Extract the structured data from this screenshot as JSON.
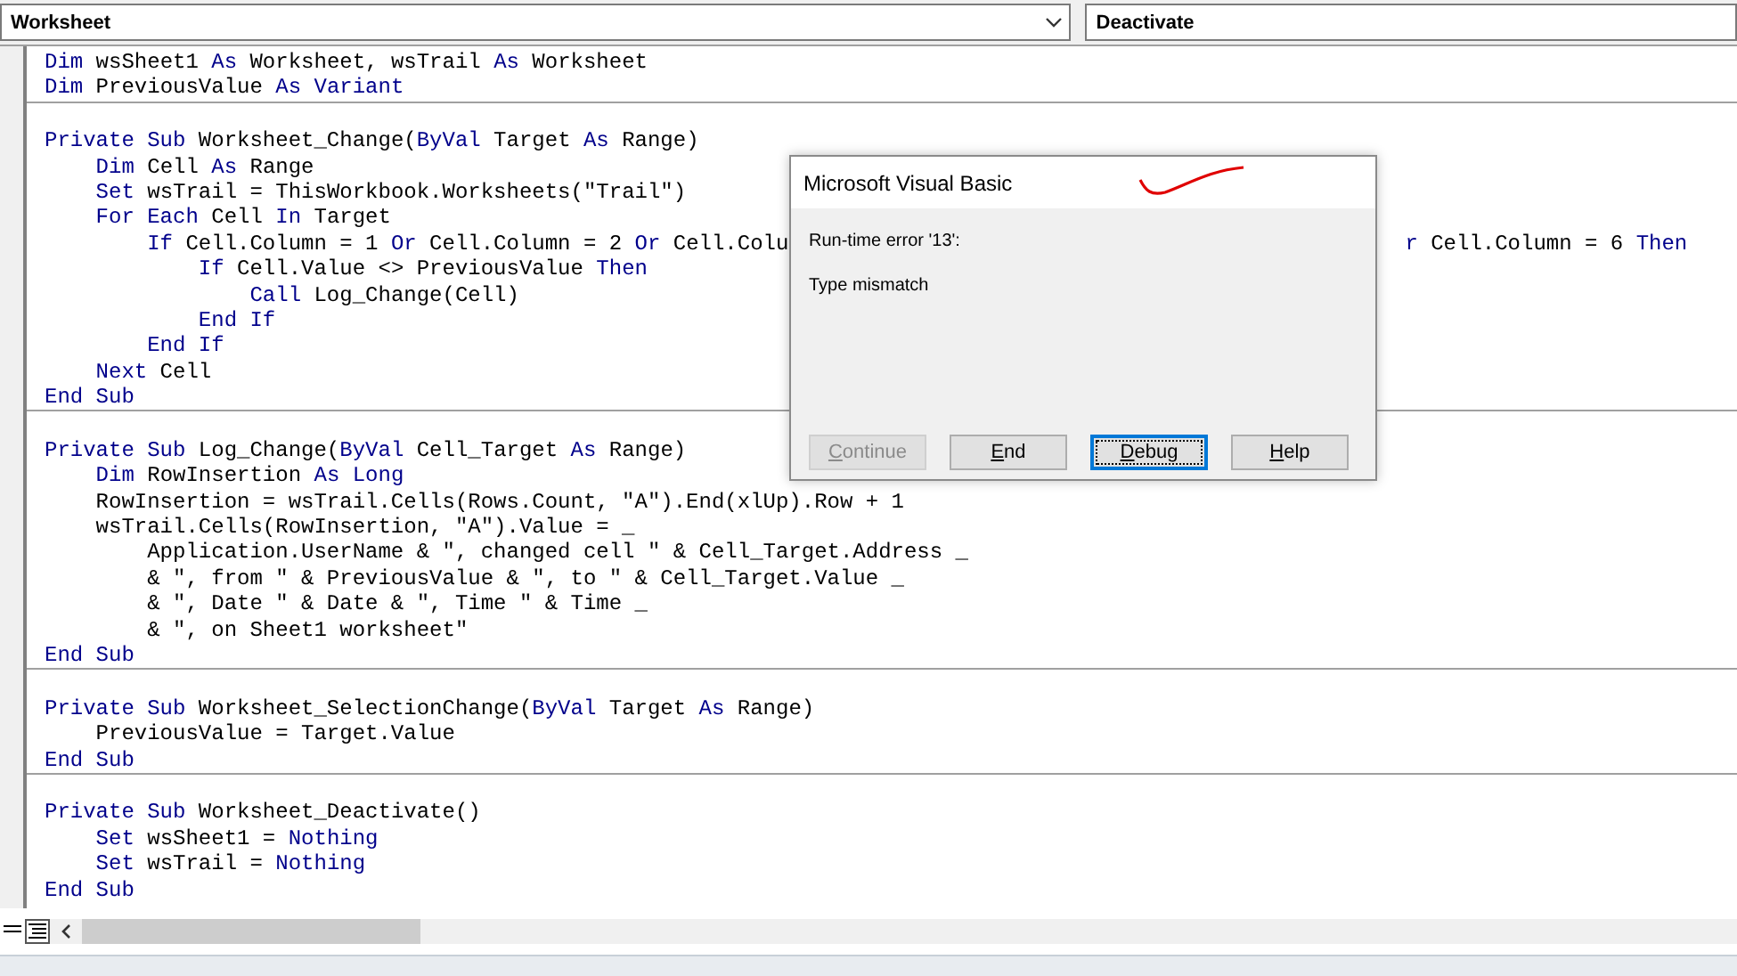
{
  "object_box": {
    "value": "Worksheet",
    "has_arrow": true
  },
  "procedure_box": {
    "value": "Deactivate",
    "has_arrow": false
  },
  "code_blocks": [
    {
      "lines": [
        {
          "segments": [
            {
              "text": "Dim",
              "kind": "keyword"
            },
            {
              "text": " wsSheet1 ",
              "kind": "plain"
            },
            {
              "text": "As",
              "kind": "keyword"
            },
            {
              "text": " Worksheet, wsTrail ",
              "kind": "plain"
            },
            {
              "text": "As",
              "kind": "keyword"
            },
            {
              "text": " Worksheet",
              "kind": "plain"
            }
          ]
        },
        {
          "segments": [
            {
              "text": "Dim",
              "kind": "keyword"
            },
            {
              "text": " PreviousValue ",
              "kind": "plain"
            },
            {
              "text": "As Variant",
              "kind": "keyword"
            }
          ]
        }
      ]
    },
    {
      "lines": [
        {
          "segments": [
            {
              "text": "Private Sub",
              "kind": "keyword"
            },
            {
              "text": " Worksheet_Change(",
              "kind": "plain"
            },
            {
              "text": "ByVal",
              "kind": "keyword"
            },
            {
              "text": " Target ",
              "kind": "plain"
            },
            {
              "text": "As",
              "kind": "keyword"
            },
            {
              "text": " Range)",
              "kind": "plain"
            }
          ]
        },
        {
          "segments": [
            {
              "text": "    Dim",
              "kind": "keyword"
            },
            {
              "text": " Cell ",
              "kind": "plain"
            },
            {
              "text": "As",
              "kind": "keyword"
            },
            {
              "text": " Range",
              "kind": "plain"
            }
          ]
        },
        {
          "segments": [
            {
              "text": "    Set",
              "kind": "keyword"
            },
            {
              "text": " wsTrail = ThisWorkbook.Worksheets(\"Trail\")",
              "kind": "plain"
            }
          ]
        },
        {
          "segments": [
            {
              "text": "    For Each",
              "kind": "keyword"
            },
            {
              "text": " Cell ",
              "kind": "plain"
            },
            {
              "text": "In",
              "kind": "keyword"
            },
            {
              "text": " Target",
              "kind": "plain"
            }
          ]
        },
        {
          "segments": [
            {
              "text": "        If",
              "kind": "keyword"
            },
            {
              "text": " Cell.Column = 1 ",
              "kind": "plain"
            },
            {
              "text": "Or",
              "kind": "keyword"
            },
            {
              "text": " Cell.Column = 2 ",
              "kind": "plain"
            },
            {
              "text": "Or",
              "kind": "keyword"
            },
            {
              "text": " Cell.Colu",
              "kind": "plain"
            }
          ],
          "after_dialog": [
            {
              "text": "r",
              "kind": "keyword"
            },
            {
              "text": " Cell.Column = 6 ",
              "kind": "plain"
            },
            {
              "text": "Then",
              "kind": "keyword"
            }
          ]
        },
        {
          "segments": [
            {
              "text": "            If",
              "kind": "keyword"
            },
            {
              "text": " Cell.Value <> PreviousValue ",
              "kind": "plain"
            },
            {
              "text": "Then",
              "kind": "keyword"
            }
          ]
        },
        {
          "segments": [
            {
              "text": "                Call",
              "kind": "keyword"
            },
            {
              "text": " Log_Change(Cell)",
              "kind": "plain"
            }
          ]
        },
        {
          "segments": [
            {
              "text": "            End If",
              "kind": "keyword"
            }
          ]
        },
        {
          "segments": [
            {
              "text": "        End If",
              "kind": "keyword"
            }
          ]
        },
        {
          "segments": [
            {
              "text": "    Next",
              "kind": "keyword"
            },
            {
              "text": " Cell",
              "kind": "plain"
            }
          ]
        },
        {
          "segments": [
            {
              "text": "End Sub",
              "kind": "keyword"
            }
          ]
        }
      ]
    },
    {
      "lines": [
        {
          "segments": [
            {
              "text": "Private Sub",
              "kind": "keyword"
            },
            {
              "text": " Log_Change(",
              "kind": "plain"
            },
            {
              "text": "ByVal",
              "kind": "keyword"
            },
            {
              "text": " Cell_Target ",
              "kind": "plain"
            },
            {
              "text": "As",
              "kind": "keyword"
            },
            {
              "text": " Range)",
              "kind": "plain"
            }
          ]
        },
        {
          "segments": [
            {
              "text": "    Dim",
              "kind": "keyword"
            },
            {
              "text": " RowInsertion ",
              "kind": "plain"
            },
            {
              "text": "As Long",
              "kind": "keyword"
            }
          ]
        },
        {
          "segments": [
            {
              "text": "    RowInsertion = wsTrail.Cells(Rows.Count, \"A\").End(xlUp).Row + 1",
              "kind": "plain"
            }
          ]
        },
        {
          "segments": [
            {
              "text": "    wsTrail.Cells(RowInsertion, \"A\").Value = _",
              "kind": "plain"
            }
          ]
        },
        {
          "segments": [
            {
              "text": "        Application.UserName & \", changed cell \" & Cell_Target.Address _",
              "kind": "plain"
            }
          ]
        },
        {
          "segments": [
            {
              "text": "        & \", from \" & PreviousValue & \", to \" & Cell_Target.Value _",
              "kind": "plain"
            }
          ]
        },
        {
          "segments": [
            {
              "text": "        & \", Date \" & Date & \", Time \" & Time _",
              "kind": "plain"
            }
          ]
        },
        {
          "segments": [
            {
              "text": "        & \", on Sheet1 worksheet\"",
              "kind": "plain"
            }
          ]
        },
        {
          "segments": [
            {
              "text": "End Sub",
              "kind": "keyword"
            }
          ]
        }
      ]
    },
    {
      "lines": [
        {
          "segments": [
            {
              "text": "Private Sub",
              "kind": "keyword"
            },
            {
              "text": " Worksheet_SelectionChange(",
              "kind": "plain"
            },
            {
              "text": "ByVal",
              "kind": "keyword"
            },
            {
              "text": " Target ",
              "kind": "plain"
            },
            {
              "text": "As",
              "kind": "keyword"
            },
            {
              "text": " Range)",
              "kind": "plain"
            }
          ]
        },
        {
          "segments": [
            {
              "text": "    PreviousValue = Target.Value",
              "kind": "plain"
            }
          ]
        },
        {
          "segments": [
            {
              "text": "End Sub",
              "kind": "keyword"
            }
          ]
        }
      ]
    },
    {
      "lines": [
        {
          "segments": [
            {
              "text": "Private Sub",
              "kind": "keyword"
            },
            {
              "text": " Worksheet_Deactivate()",
              "kind": "plain"
            }
          ]
        },
        {
          "segments": [
            {
              "text": "    Set",
              "kind": "keyword"
            },
            {
              "text": " wsSheet1 = ",
              "kind": "plain"
            },
            {
              "text": "Nothing",
              "kind": "keyword"
            }
          ]
        },
        {
          "segments": [
            {
              "text": "    Set",
              "kind": "keyword"
            },
            {
              "text": " wsTrail = ",
              "kind": "plain"
            },
            {
              "text": "Nothing",
              "kind": "keyword"
            }
          ]
        },
        {
          "segments": [
            {
              "text": "End Sub",
              "kind": "keyword"
            }
          ]
        }
      ]
    }
  ],
  "dialog": {
    "title": "Microsoft Visual Basic",
    "message": "Run-time error '13':",
    "detail": "Type mismatch",
    "buttons": [
      {
        "key": "C",
        "rest": "ontinue",
        "disabled": true,
        "focused": false
      },
      {
        "key": "E",
        "rest": "nd",
        "disabled": false,
        "focused": false
      },
      {
        "key": "D",
        "rest": "ebug",
        "disabled": false,
        "focused": true
      },
      {
        "key": "H",
        "rest": "elp",
        "disabled": false,
        "focused": false
      }
    ]
  }
}
